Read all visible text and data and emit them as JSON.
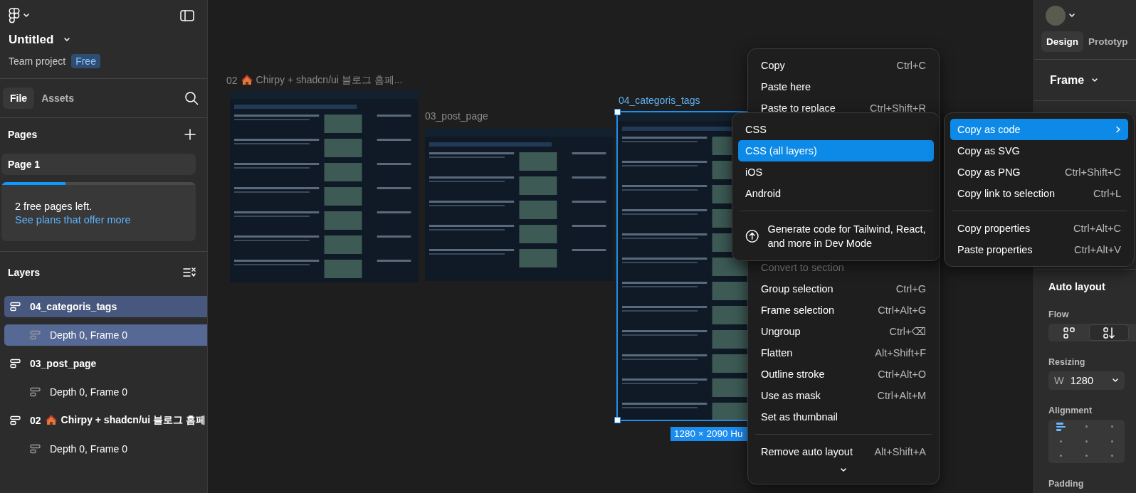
{
  "left_panel": {
    "file_title": "Untitled",
    "project": "Team project",
    "plan_badge": "Free",
    "tabs": [
      {
        "label": "File",
        "selected": true
      },
      {
        "label": "Assets",
        "selected": false
      }
    ],
    "pages_heading": "Pages",
    "pages": [
      {
        "label": "Page 1",
        "selected": true
      }
    ],
    "upgrade_card": {
      "level": 0.33,
      "message": "2 free pages left.",
      "link": "See plans that offer more"
    },
    "layers_heading": "Layers",
    "layers": [
      {
        "prefix": "04_categoris_tags",
        "selected": true,
        "children": [
          {
            "prefix": "Depth 0, Frame 0",
            "selected": true
          }
        ]
      },
      {
        "prefix": "03_post_page",
        "selected": false,
        "children": [
          {
            "prefix": "Depth 0, Frame 0",
            "selected": false
          }
        ]
      },
      {
        "prefix": "02",
        "house": true,
        "name": "Chirpy + shadcn/ui 블로그 홈페",
        "selected": false,
        "children": [
          {
            "prefix": "Depth 0, Frame 0",
            "selected": false
          }
        ]
      }
    ]
  },
  "canvas": {
    "frames": [
      {
        "prefix": "02",
        "house": true,
        "name": "Chirpy + shadcn/ui 블로그 홈페...",
        "selected": false
      },
      {
        "prefix": "03_post_page",
        "selected": false
      },
      {
        "prefix": "04_categoris_tags",
        "selected": true
      }
    ],
    "size_badge": "1280 × 2090 Hu"
  },
  "context_menu": {
    "items": [
      {
        "kind": "item",
        "label": "Copy",
        "shortcut": "Ctrl+C",
        "disabled": false
      },
      {
        "kind": "item",
        "label": "Paste here",
        "disabled": false
      },
      {
        "kind": "item",
        "label": "Paste to replace",
        "shortcut": "Ctrl+Shift+R",
        "disabled": false
      },
      {
        "kind": "hidden"
      },
      {
        "kind": "item",
        "label": "Convert to section",
        "disabled": true
      },
      {
        "kind": "item",
        "label": "Group selection",
        "shortcut": "Ctrl+G",
        "disabled": false
      },
      {
        "kind": "item",
        "label": "Frame selection",
        "shortcut": "Ctrl+Alt+G",
        "disabled": false
      },
      {
        "kind": "item",
        "label": "Ungroup",
        "shortcut": "Ctrl+⌫",
        "disabled": false
      },
      {
        "kind": "item",
        "label": "Flatten",
        "shortcut": "Alt+Shift+F",
        "disabled": false
      },
      {
        "kind": "item",
        "label": "Outline stroke",
        "shortcut": "Ctrl+Alt+O",
        "disabled": false
      },
      {
        "kind": "item",
        "label": "Use as mask",
        "shortcut": "Ctrl+Alt+M",
        "disabled": false
      },
      {
        "kind": "item",
        "label": "Set as thumbnail",
        "disabled": false
      },
      {
        "kind": "separator"
      },
      {
        "kind": "item",
        "label": "Remove auto layout",
        "shortcut": "Alt+Shift+A",
        "disabled": false
      },
      {
        "kind": "more"
      }
    ]
  },
  "copy_as_menu": {
    "items": [
      {
        "kind": "item",
        "label": "Copy as code",
        "submenu": true,
        "selected": true
      },
      {
        "kind": "item",
        "label": "Copy as SVG",
        "selected": false
      },
      {
        "kind": "item",
        "label": "Copy as PNG",
        "shortcut": "Ctrl+Shift+C",
        "selected": false
      },
      {
        "kind": "item",
        "label": "Copy link to selection",
        "shortcut": "Ctrl+L",
        "selected": false
      },
      {
        "kind": "separator"
      },
      {
        "kind": "item",
        "label": "Copy properties",
        "shortcut": "Ctrl+Alt+C",
        "selected": false
      },
      {
        "kind": "item",
        "label": "Paste properties",
        "shortcut": "Ctrl+Alt+V",
        "selected": false
      }
    ]
  },
  "code_menu": {
    "items": [
      {
        "kind": "item",
        "label": "CSS",
        "selected": false
      },
      {
        "kind": "item",
        "label": "CSS (all layers)",
        "selected": true
      },
      {
        "kind": "item",
        "label": "iOS",
        "selected": false
      },
      {
        "kind": "item",
        "label": "Android",
        "selected": false
      },
      {
        "kind": "separator"
      },
      {
        "kind": "devmode",
        "label": "Generate code for Tailwind, React, and more in Dev Mode",
        "selected": false
      }
    ]
  },
  "right_panel": {
    "tabs": [
      {
        "label": "Design",
        "selected": true
      },
      {
        "label": "Prototyp",
        "selected": false
      }
    ],
    "frame_type": "Frame",
    "auto_layout_heading": "Auto layout",
    "flow_label": "Flow",
    "flow_options": [
      {
        "kind": "wrap",
        "selected": false
      },
      {
        "kind": "vertical",
        "selected": true
      }
    ],
    "resizing_label": "Resizing",
    "width_label": "W",
    "width_value": "1280",
    "alignment_label": "Alignment",
    "alignment_grid": [
      {
        "selected": true
      },
      {
        "selected": false
      },
      {
        "selected": false
      },
      {
        "selected": false
      },
      {
        "selected": false
      },
      {
        "selected": false
      },
      {
        "selected": false
      },
      {
        "selected": false
      },
      {
        "selected": false
      }
    ],
    "padding_label": "Padding"
  }
}
